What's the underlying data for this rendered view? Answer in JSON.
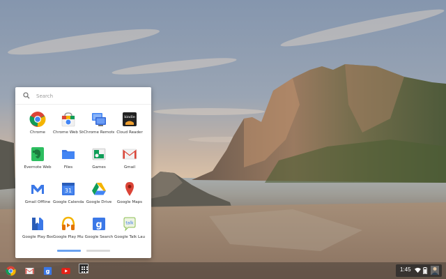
{
  "launcher": {
    "search_placeholder": "Search",
    "apps": [
      {
        "label": "Chrome",
        "icon": "chrome-icon"
      },
      {
        "label": "Chrome Web Store",
        "icon": "chrome-web-store-icon"
      },
      {
        "label": "Chrome Remote Desktop",
        "icon": "chrome-remote-desktop-icon"
      },
      {
        "label": "Cloud Reader",
        "icon": "kindle-icon"
      },
      {
        "label": "Evernote Web",
        "icon": "evernote-icon"
      },
      {
        "label": "Files",
        "icon": "folder-icon"
      },
      {
        "label": "Games",
        "icon": "games-icon"
      },
      {
        "label": "Gmail",
        "icon": "gmail-icon"
      },
      {
        "label": "Gmail Offline",
        "icon": "gmail-offline-icon"
      },
      {
        "label": "Google Calendar",
        "icon": "calendar-icon"
      },
      {
        "label": "Google Drive",
        "icon": "drive-icon"
      },
      {
        "label": "Google Maps",
        "icon": "maps-pin-icon"
      },
      {
        "label": "Google Play Books",
        "icon": "play-books-icon"
      },
      {
        "label": "Google Play Music",
        "icon": "play-music-icon"
      },
      {
        "label": "Google Search",
        "icon": "google-search-icon"
      },
      {
        "label": "Google Talk Launcher",
        "icon": "talk-icon"
      }
    ],
    "calendar_day": "31",
    "kindle_text": "kindle",
    "talk_text": "talk",
    "pages": 2,
    "current_page": 1
  },
  "shelf": {
    "items": [
      "chrome-icon",
      "gmail-icon",
      "google-search-icon",
      "youtube-icon",
      "app-launcher-icon"
    ]
  },
  "tray": {
    "time": "1:45"
  },
  "colors": {
    "google_blue": "#4285f4",
    "google_red": "#db4437",
    "google_green": "#0f9d58",
    "google_yellow": "#f4b400",
    "pager_active": "#6aa2f0"
  }
}
